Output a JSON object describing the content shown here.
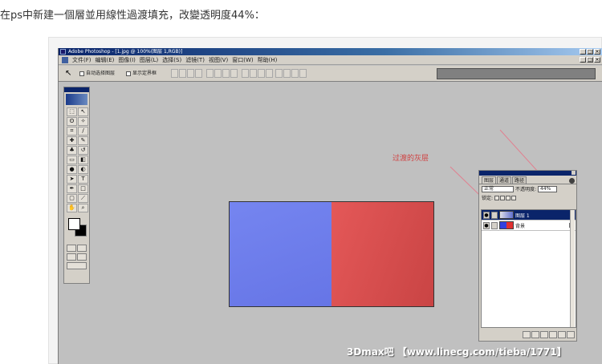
{
  "post": {
    "text": "在ps中新建一個層並用線性過渡填充，改變透明度44%："
  },
  "window": {
    "title": "Adobe Photoshop - [1.jpg @ 100%(图层 1,RGB)]",
    "minimize": "_",
    "maximize": "□",
    "close": "×"
  },
  "menubar": {
    "items": [
      "文件(F)",
      "编辑(E)",
      "图像(I)",
      "图层(L)",
      "选择(S)",
      "滤镜(T)",
      "视图(V)",
      "窗口(W)",
      "帮助(H)"
    ]
  },
  "options": {
    "auto_select": "自动选择图层",
    "show_bounds": "显示定界框"
  },
  "annotation": {
    "text": "过渡的灰层"
  },
  "layers_panel": {
    "tabs": [
      "图层",
      "通道",
      "路径"
    ],
    "blend_mode": "正常",
    "opacity_label": "不透明度:",
    "opacity_value": "44%",
    "lock_label": "锁定:",
    "layers": [
      {
        "name": "图层 1",
        "selected": true
      },
      {
        "name": "背景",
        "selected": false
      }
    ]
  },
  "watermark": {
    "text": "3Dmax吧 【www.linecg.com/tieba/1771】"
  },
  "colors": {
    "left_half": "#6f7ff0",
    "right_half": "#d94d4d",
    "annotation": "#d04040"
  }
}
